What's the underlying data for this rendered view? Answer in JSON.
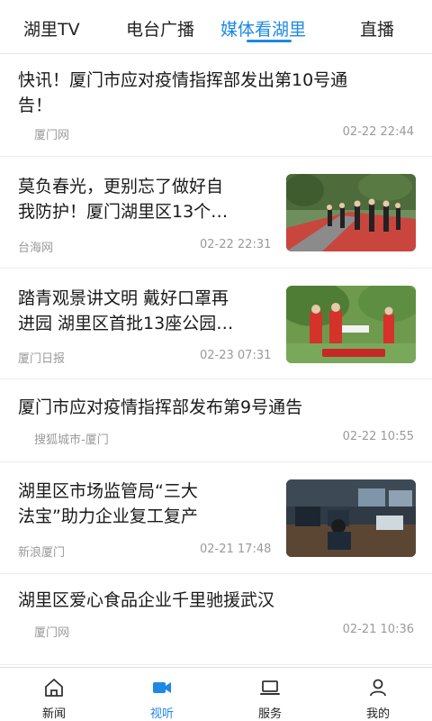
{
  "tabs": [
    {
      "label": "湖里TV"
    },
    {
      "label": "电台广播"
    },
    {
      "label": "媒体看湖里"
    },
    {
      "label": "直播"
    }
  ],
  "active_tab": "媒体看湖里",
  "news": [
    {
      "title": "快讯！厦门市应对疫情指挥部发出第10号通告！",
      "title_l1": "快讯！厦门市应对疫情指挥部发出第10号通",
      "title_l2": "告！",
      "source": "厦门网",
      "time": "02-22 22:44",
      "has_image": false
    },
    {
      "title_l1": "莫负春光，更别忘了做好自",
      "title_l2": "我防护！厦门湖里区13个…",
      "source": "台海网",
      "time": "02-22 22:31",
      "has_image": true,
      "image_desc": "people walking on road"
    },
    {
      "title_l1": "踏青观景讲文明 戴好口罩再",
      "title_l2": "进园 湖里区首批13座公园…",
      "source": "厦门日报",
      "time": "02-23 07:31",
      "has_image": true,
      "image_desc": "people in red vests in park"
    },
    {
      "title_l1": "厦门市应对疫情指挥部发布第9号通告",
      "source": "搜狐城市-厦门",
      "time": "02-22 10:55",
      "has_image": false
    },
    {
      "title_l1": "湖里区市场监管局“三大",
      "title_l2": "法宝”助力企业复工复产",
      "source": "新浪厦门",
      "time": "02-21 17:48",
      "has_image": true,
      "image_desc": "office with computers"
    },
    {
      "title_l1": "湖里区爱心食品企业千里驰援武汉",
      "source": "厦门网",
      "time": "02-21 10:36",
      "has_image": false
    }
  ],
  "bottom_nav": [
    {
      "label": "新闻",
      "icon": "home-icon"
    },
    {
      "label": "视听",
      "icon": "video-icon"
    },
    {
      "label": "服务",
      "icon": "laptop-icon"
    },
    {
      "label": "我的",
      "icon": "user-icon"
    }
  ],
  "colors": {
    "accent": "#1e88e5",
    "text": "#1a1a1a",
    "meta": "#9a9a9a"
  }
}
